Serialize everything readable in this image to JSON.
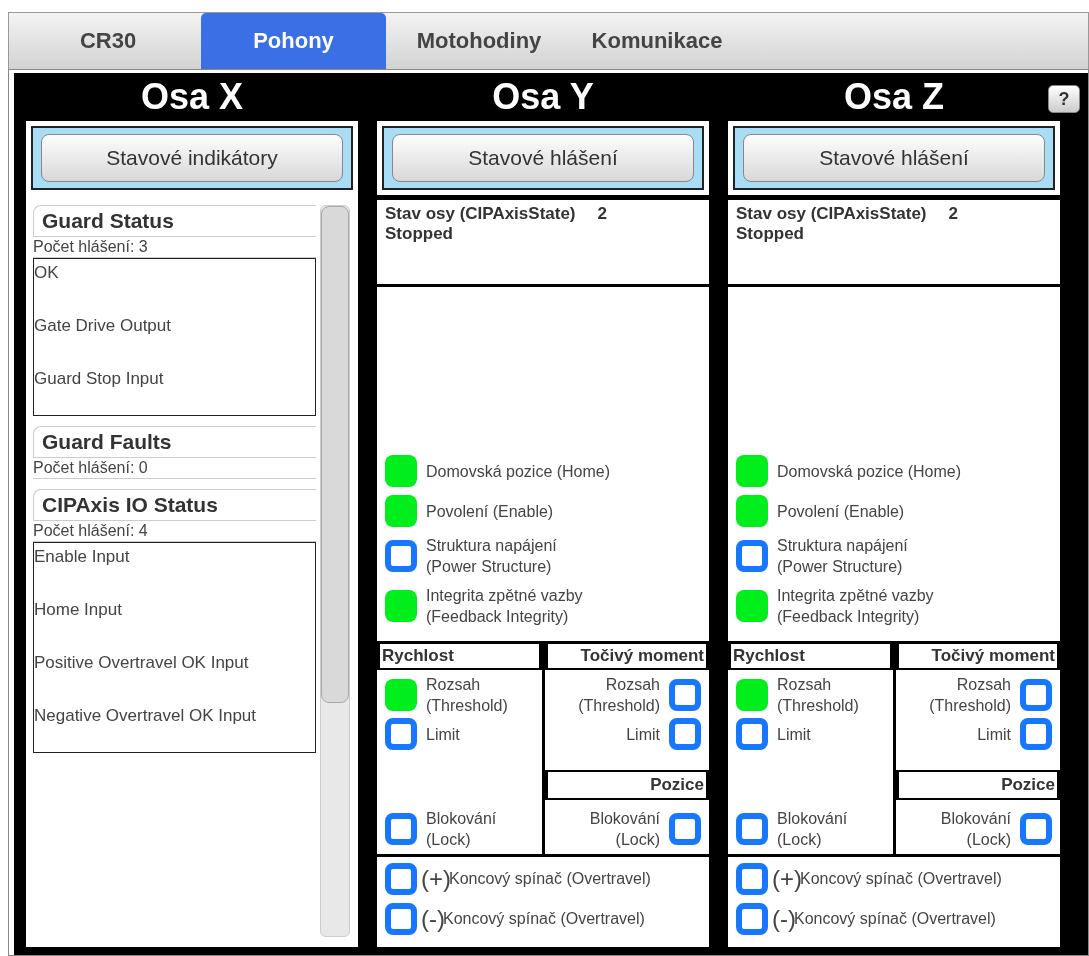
{
  "tabs": [
    {
      "label": "CR30",
      "selected": false
    },
    {
      "label": "Pohony",
      "selected": true
    },
    {
      "label": "Motohodiny",
      "selected": false
    },
    {
      "label": "Komunikace",
      "selected": false
    }
  ],
  "help_button": "?",
  "axes": [
    {
      "kind": "status-list",
      "title": "Osa X",
      "button": "Stavové indikátory",
      "groups": [
        {
          "title": "Guard Status",
          "count_label": "Počet hlášení:",
          "count": "3",
          "messages": [
            "OK",
            "Gate Drive Output",
            "Guard Stop Input"
          ]
        },
        {
          "title": "Guard Faults",
          "count_label": "Počet hlášení:",
          "count": "0"
        },
        {
          "title": "CIPAxis IO Status",
          "count_label": "Počet hlášení:",
          "count": "4",
          "messages": [
            "Enable Input",
            "Home Input",
            "Positive Overtravel OK Input",
            "Negative Overtravel OK Input"
          ]
        }
      ]
    },
    {
      "kind": "drive",
      "title": "Osa Y",
      "button": "Stavové hlášení",
      "state_label": "Stav osy (CIPAxisState)",
      "state_code": "2",
      "state_text": "Stopped",
      "indicators": [
        {
          "lines": [
            "Domovská pozice (Home)"
          ],
          "on": true
        },
        {
          "lines": [
            "Povolení (Enable)"
          ],
          "on": true
        },
        {
          "lines": [
            "Struktura napájení",
            "(Power Structure)"
          ],
          "on": false
        },
        {
          "lines": [
            "Integrita zpětné vazby",
            "(Feedback Integrity)"
          ],
          "on": true
        }
      ],
      "speed": {
        "title": "Rychlost",
        "top": [
          {
            "lines": [
              "Rozsah",
              "(Threshold)"
            ],
            "on": true
          },
          {
            "lines": [
              "Limit"
            ],
            "on": false
          }
        ],
        "bottom": [
          {
            "lines": [
              "Blokování",
              "(Lock)"
            ],
            "on": false
          }
        ]
      },
      "torque": {
        "title": "Točivý moment",
        "items": [
          {
            "lines": [
              "Rozsah",
              "(Threshold)"
            ],
            "on": false
          },
          {
            "lines": [
              "Limit"
            ],
            "on": false
          }
        ]
      },
      "position": {
        "title": "Pozice",
        "items": [
          {
            "lines": [
              "Blokování",
              "(Lock)"
            ],
            "on": false
          }
        ]
      },
      "overtravel": [
        {
          "sign": "(+)",
          "label": "Koncový spínač (Overtravel)",
          "on": false
        },
        {
          "sign": "(-)",
          "label": "Koncový spínač (Overtravel)",
          "on": false
        }
      ]
    },
    {
      "kind": "drive",
      "title": "Osa Z",
      "button": "Stavové hlášení",
      "state_label": "Stav osy (CIPAxisState)",
      "state_code": "2",
      "state_text": "Stopped",
      "indicators": [
        {
          "lines": [
            "Domovská pozice (Home)"
          ],
          "on": true
        },
        {
          "lines": [
            "Povolení (Enable)"
          ],
          "on": true
        },
        {
          "lines": [
            "Struktura napájení",
            "(Power Structure)"
          ],
          "on": false
        },
        {
          "lines": [
            "Integrita zpětné vazby",
            "(Feedback Integrity)"
          ],
          "on": true
        }
      ],
      "speed": {
        "title": "Rychlost",
        "top": [
          {
            "lines": [
              "Rozsah",
              "(Threshold)"
            ],
            "on": true
          },
          {
            "lines": [
              "Limit"
            ],
            "on": false
          }
        ],
        "bottom": [
          {
            "lines": [
              "Blokování",
              "(Lock)"
            ],
            "on": false
          }
        ]
      },
      "torque": {
        "title": "Točivý moment",
        "items": [
          {
            "lines": [
              "Rozsah",
              "(Threshold)"
            ],
            "on": false
          },
          {
            "lines": [
              "Limit"
            ],
            "on": false
          }
        ]
      },
      "position": {
        "title": "Pozice",
        "items": [
          {
            "lines": [
              "Blokování",
              "(Lock)"
            ],
            "on": false
          }
        ]
      },
      "overtravel": [
        {
          "sign": "(+)",
          "label": "Koncový spínač (Overtravel)",
          "on": false
        },
        {
          "sign": "(-)",
          "label": "Koncový spínač (Overtravel)",
          "on": false
        }
      ]
    }
  ]
}
